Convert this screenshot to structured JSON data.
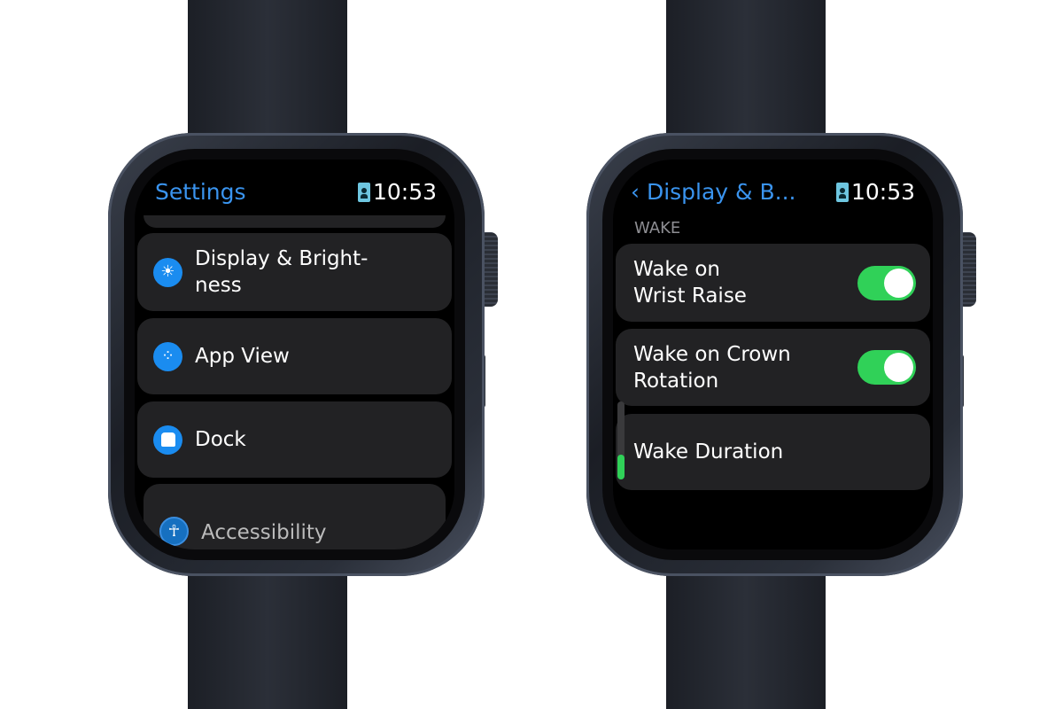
{
  "left_watch": {
    "header": {
      "title": "Settings",
      "time": "10:53"
    },
    "items": [
      {
        "label": "Display & Bright-\nness",
        "icon": "sun-icon"
      },
      {
        "label": "App View",
        "icon": "app-grid-icon"
      },
      {
        "label": "Dock",
        "icon": "dock-icon"
      },
      {
        "label": "Accessibility",
        "icon": "accessibility-icon"
      }
    ]
  },
  "right_watch": {
    "header": {
      "back_title": "Display & B...",
      "time": "10:53"
    },
    "section": "WAKE",
    "items": [
      {
        "label": "Wake on\nWrist Raise",
        "toggle_on": true
      },
      {
        "label": "Wake on Crown\nRotation",
        "toggle_on": true
      },
      {
        "label": "Wake Duration"
      }
    ]
  },
  "colors": {
    "accent": "#3a94ef",
    "toggle_on": "#30d158",
    "row_bg": "#222224"
  }
}
